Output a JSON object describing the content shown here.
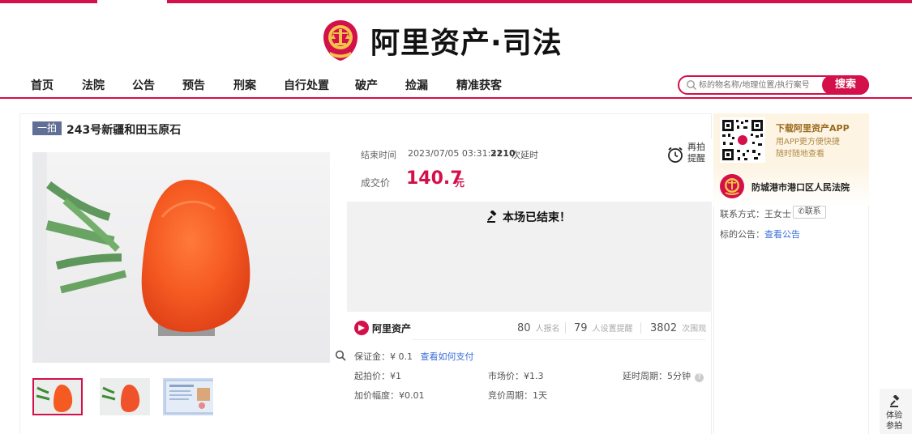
{
  "header": {
    "logo_text": "阿里资产·司法"
  },
  "nav": {
    "items": [
      "首页",
      "法院",
      "公告",
      "预告",
      "刑案",
      "自行处置",
      "破产",
      "捡漏",
      "精准获客"
    ]
  },
  "search": {
    "placeholder": "标的物名称/地理位置/执行案号",
    "button": "搜索"
  },
  "item": {
    "tag": "一拍",
    "title": "243号新疆和田玉原石"
  },
  "auction": {
    "end_label": "结束时间",
    "end_time": "2023/07/05 03:31:31",
    "delay_count": "2210",
    "delay_text": "次延时",
    "remind_label": "再拍提醒",
    "deal_label": "成交价",
    "deal_price": "140.7",
    "deal_unit": "元",
    "ended_text": "本场已结束！"
  },
  "stats": {
    "brand": "阿里资产",
    "signups": "80",
    "signups_label": "人报名",
    "reminders": "79",
    "reminders_label": "人设置提醒",
    "views": "3802",
    "views_label": "次围观"
  },
  "details": {
    "deposit_label": "保证金：¥ 0.1",
    "deposit_link": "查看如何支付",
    "start_price": "起拍价：¥1",
    "market_price": "市场价：¥1.3",
    "delay_cycle": "延时周期：5分钟",
    "increment": "加价幅度：¥0.01",
    "bid_cycle": "竞价周期：1天"
  },
  "sidebar": {
    "app_title": "下载阿里资产APP",
    "app_desc_1": "用APP更方便快捷",
    "app_desc_2": "随时随地查看",
    "court_name": "防城港市港口区人民法院",
    "contact_label": "联系方式：王女士",
    "contact_button": "联系",
    "notice_label": "标的公告：",
    "notice_link": "查看公告"
  },
  "floating": {
    "experience_label": "体验参拍"
  },
  "colors": {
    "brand_red": "#d3104a",
    "link_blue": "#3a6fd8"
  }
}
